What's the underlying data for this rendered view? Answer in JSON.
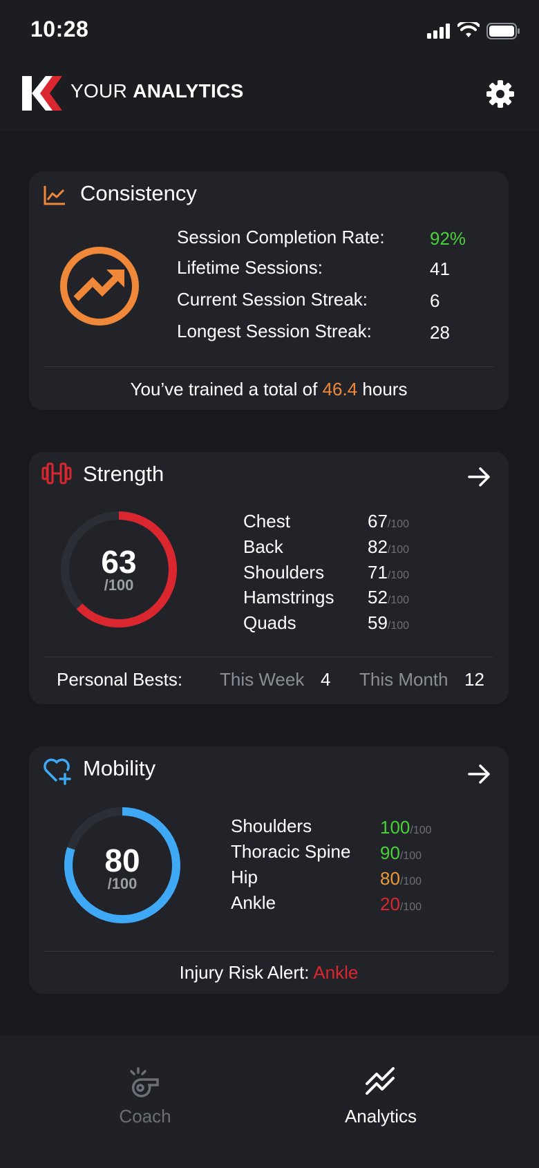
{
  "status_bar": {
    "time": "10:28"
  },
  "header": {
    "title_prefix": "YOUR",
    "title_bold": "ANALYTICS"
  },
  "colors": {
    "orange": "#f0883a",
    "red": "#d9262f",
    "blue": "#3fa9f5",
    "green": "#49d13a",
    "amber": "#e89b3a"
  },
  "consistency": {
    "title": "Consistency",
    "rows": [
      {
        "label": "Session Completion Rate:",
        "value": "92%"
      },
      {
        "label": "Lifetime Sessions:",
        "value": "41"
      },
      {
        "label": "Current Session Streak:",
        "value": "6"
      },
      {
        "label": "Longest Session Streak:",
        "value": "28"
      }
    ],
    "footer_prefix": "You’ve trained a total of",
    "footer_value": "46.4",
    "footer_suffix": "hours"
  },
  "strength": {
    "title": "Strength",
    "score": "63",
    "score_max": "/100",
    "score_fraction": 0.63,
    "rows": [
      {
        "label": "Chest",
        "value": "67",
        "unit": "/100"
      },
      {
        "label": "Back",
        "value": "82",
        "unit": "/100"
      },
      {
        "label": "Shoulders",
        "value": "71",
        "unit": "/100"
      },
      {
        "label": "Hamstrings",
        "value": "52",
        "unit": "/100"
      },
      {
        "label": "Quads",
        "value": "59",
        "unit": "/100"
      }
    ],
    "pb_label": "Personal Bests:",
    "pb_week_label": "This Week",
    "pb_week_value": "4",
    "pb_month_label": "This Month",
    "pb_month_value": "12"
  },
  "mobility": {
    "title": "Mobility",
    "score": "80",
    "score_max": "/100",
    "score_fraction": 0.8,
    "rows": [
      {
        "label": "Shoulders",
        "value": "100",
        "unit": "/100"
      },
      {
        "label": "Thoracic Spine",
        "value": "90",
        "unit": "/100"
      },
      {
        "label": "Hip",
        "value": "80",
        "unit": "/100"
      },
      {
        "label": "Ankle",
        "value": "20",
        "unit": "/100"
      }
    ],
    "alert_label": "Injury Risk Alert:",
    "alert_value": "Ankle"
  },
  "tabs": [
    {
      "label": "Coach"
    },
    {
      "label": "Analytics"
    }
  ]
}
